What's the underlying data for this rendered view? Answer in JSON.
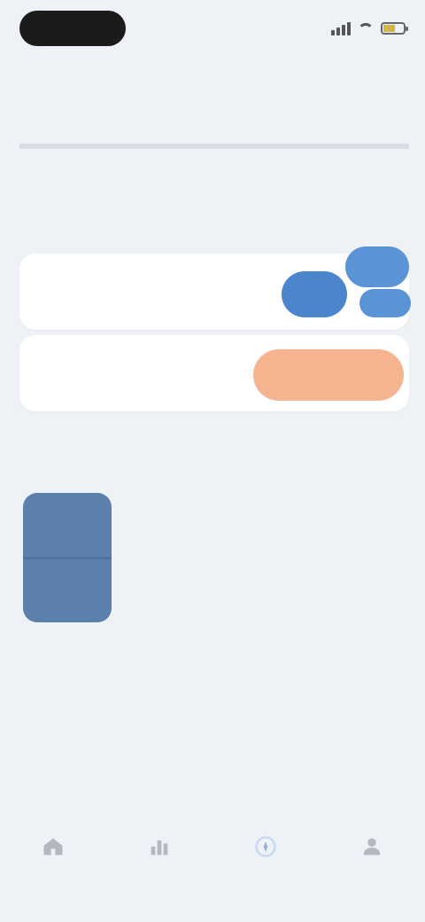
{
  "status_bar": {
    "time": ""
  },
  "header": {
    "title": ""
  },
  "section": {
    "title": ""
  },
  "subheading": "",
  "options": [
    {
      "label": ""
    },
    {
      "label": ""
    }
  ],
  "card": {
    "label": ""
  },
  "tabs": [
    {
      "icon": "home-icon",
      "label": ""
    },
    {
      "icon": "chart-icon",
      "label": ""
    },
    {
      "icon": "compass-icon",
      "label": ""
    },
    {
      "icon": "profile-icon",
      "label": ""
    }
  ],
  "colors": {
    "background": "#eef2f7",
    "accent_blue": "#4b86cc",
    "accent_orange": "#f6b390",
    "card": "#5b80ab",
    "active_tab": "#8fb3e6"
  }
}
